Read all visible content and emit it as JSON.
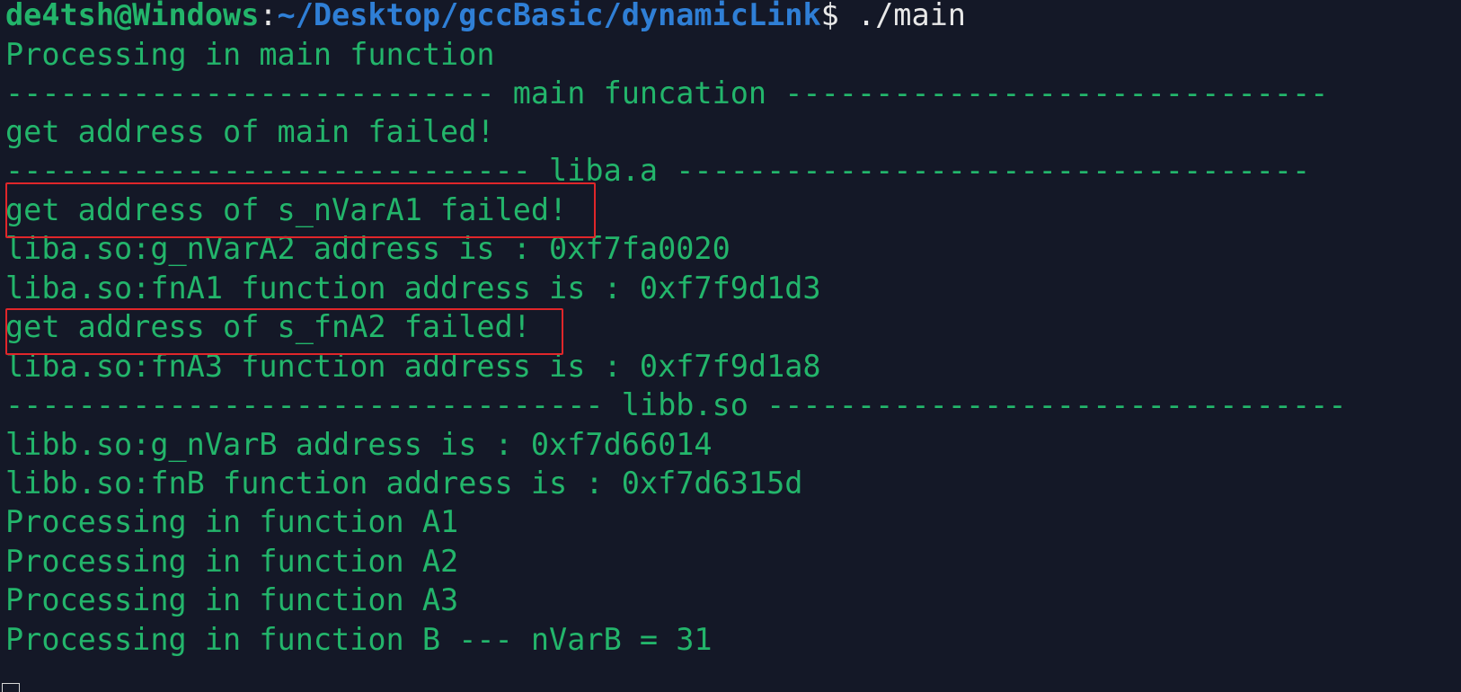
{
  "prompt": {
    "user_host": "de4tsh@Windows",
    "separator": ":",
    "path": "~/Desktop/gccBasic/dynamicLink",
    "symbol": "$",
    "command": " ./main"
  },
  "output_lines": [
    "Processing in main function",
    "--------------------------- main funcation ------------------------------",
    "get address of main failed!",
    "----------------------------- liba.a -----------------------------------",
    "get address of s_nVarA1 failed!",
    "liba.so:g_nVarA2 address is : 0xf7fa0020",
    "liba.so:fnA1 function address is : 0xf7f9d1d3",
    "get address of s_fnA2 failed!",
    "liba.so:fnA3 function address is : 0xf7f9d1a8",
    "--------------------------------- libb.so --------------------------------",
    "libb.so:g_nVarB address is : 0xf7d66014",
    "libb.so:fnB function address is : 0xf7d6315d",
    "Processing in function A1",
    "Processing in function A2",
    "Processing in function A3",
    "Processing in function B --- nVarB = 31"
  ],
  "colors": {
    "background": "#141827",
    "output_text": "#23b56b",
    "prompt_path": "#2f7fd6",
    "prompt_symbol": "#e8e8e8",
    "highlight_border": "#e0262a"
  }
}
